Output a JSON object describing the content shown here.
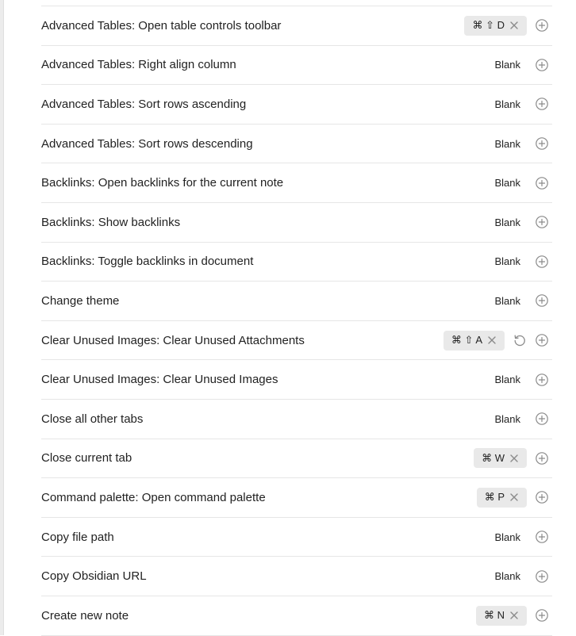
{
  "hotkeys": {
    "rows": [
      {
        "label": "Advanced Tables: Open table controls toolbar",
        "hotkey": "⌘ ⇧ D",
        "blank": null,
        "restorable": false
      },
      {
        "label": "Advanced Tables: Right align column",
        "hotkey": null,
        "blank": "Blank",
        "restorable": false
      },
      {
        "label": "Advanced Tables: Sort rows ascending",
        "hotkey": null,
        "blank": "Blank",
        "restorable": false
      },
      {
        "label": "Advanced Tables: Sort rows descending",
        "hotkey": null,
        "blank": "Blank",
        "restorable": false
      },
      {
        "label": "Backlinks: Open backlinks for the current note",
        "hotkey": null,
        "blank": "Blank",
        "restorable": false
      },
      {
        "label": "Backlinks: Show backlinks",
        "hotkey": null,
        "blank": "Blank",
        "restorable": false
      },
      {
        "label": "Backlinks: Toggle backlinks in document",
        "hotkey": null,
        "blank": "Blank",
        "restorable": false
      },
      {
        "label": "Change theme",
        "hotkey": null,
        "blank": "Blank",
        "restorable": false
      },
      {
        "label": "Clear Unused Images: Clear Unused Attachments",
        "hotkey": "⌘ ⇧ A",
        "blank": null,
        "restorable": true
      },
      {
        "label": "Clear Unused Images: Clear Unused Images",
        "hotkey": null,
        "blank": "Blank",
        "restorable": false
      },
      {
        "label": "Close all other tabs",
        "hotkey": null,
        "blank": "Blank",
        "restorable": false
      },
      {
        "label": "Close current tab",
        "hotkey": "⌘ W",
        "blank": null,
        "restorable": false
      },
      {
        "label": "Command palette: Open command palette",
        "hotkey": "⌘ P",
        "blank": null,
        "restorable": false
      },
      {
        "label": "Copy file path",
        "hotkey": null,
        "blank": "Blank",
        "restorable": false
      },
      {
        "label": "Copy Obsidian URL",
        "hotkey": null,
        "blank": "Blank",
        "restorable": false
      },
      {
        "label": "Create new note",
        "hotkey": "⌘ N",
        "blank": null,
        "restorable": false
      }
    ],
    "icons": {
      "remove": "close-icon",
      "restore": "restore-icon",
      "add": "add-circle-icon"
    },
    "colors": {
      "hotkey_bg": "#e9e9e9",
      "icon": "#8a8a8a",
      "text": "#222222",
      "divider": "#e6e6e6"
    }
  }
}
